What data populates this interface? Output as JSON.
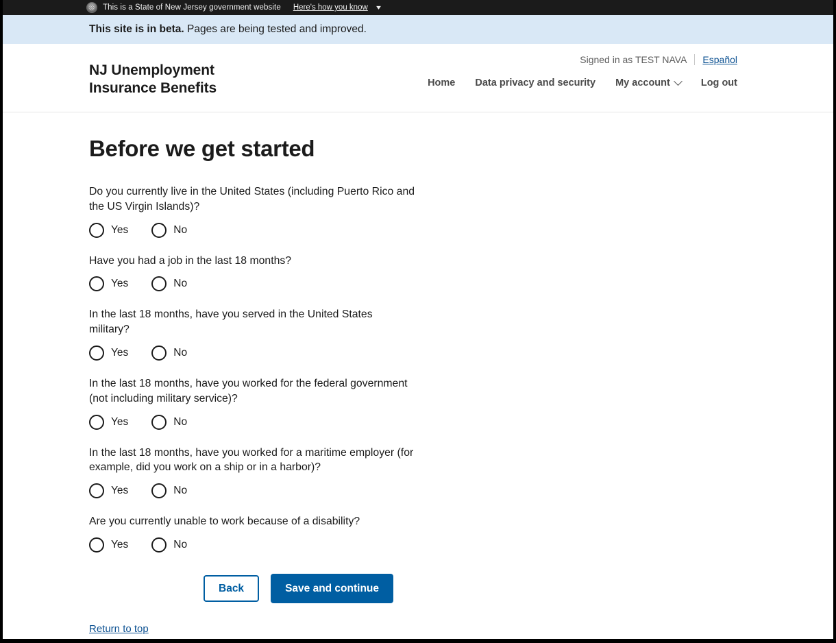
{
  "gov_banner": {
    "icon": "state-seal-icon",
    "text": "This is a State of New Jersey government website",
    "link_label": "Here's how you know",
    "chevron": "chevron-down-icon",
    "background": "#1b1b1b"
  },
  "beta_banner": {
    "bold_text": "This site is in beta.",
    "rest_text": " Pages are being tested and improved.",
    "background": "#d9e8f6"
  },
  "header": {
    "site_title": "NJ Unemployment\nInsurance Benefits",
    "signed_in_text": "Signed in as TEST NAVA",
    "language_link": "Español",
    "nav": [
      {
        "label": "Home",
        "has_chevron": false
      },
      {
        "label": "Data privacy and security",
        "has_chevron": false
      },
      {
        "label": "My account",
        "has_chevron": true
      },
      {
        "label": "Log out",
        "has_chevron": false
      }
    ]
  },
  "main": {
    "page_title": "Before we get started",
    "questions": [
      {
        "text": "Do you currently live in the United States (including Puerto Rico and the US Virgin Islands)?",
        "options": [
          "Yes",
          "No"
        ],
        "selected": null
      },
      {
        "text": "Have you had a job in the last 18 months?",
        "options": [
          "Yes",
          "No"
        ],
        "selected": null
      },
      {
        "text": "In the last 18 months, have you served in the United States military?",
        "options": [
          "Yes",
          "No"
        ],
        "selected": null
      },
      {
        "text": "In the last 18 months, have you worked for the federal government (not including military service)?",
        "options": [
          "Yes",
          "No"
        ],
        "selected": null
      },
      {
        "text": "In the last 18 months, have you worked for a maritime employer (for example, did you work on a ship or in a harbor)?",
        "options": [
          "Yes",
          "No"
        ],
        "selected": null
      },
      {
        "text": "Are you currently unable to work because of a disability?",
        "options": [
          "Yes",
          "No"
        ],
        "selected": null
      }
    ],
    "back_button": "Back",
    "submit_button": "Save and continue",
    "return_to_top": "Return to top"
  },
  "colors": {
    "primary_blue": "#005ea2",
    "link_blue": "#0b5091",
    "banner_dark": "#1b1b1b",
    "beta_blue": "#d9e8f6",
    "text_dark": "#1b1b1b"
  }
}
